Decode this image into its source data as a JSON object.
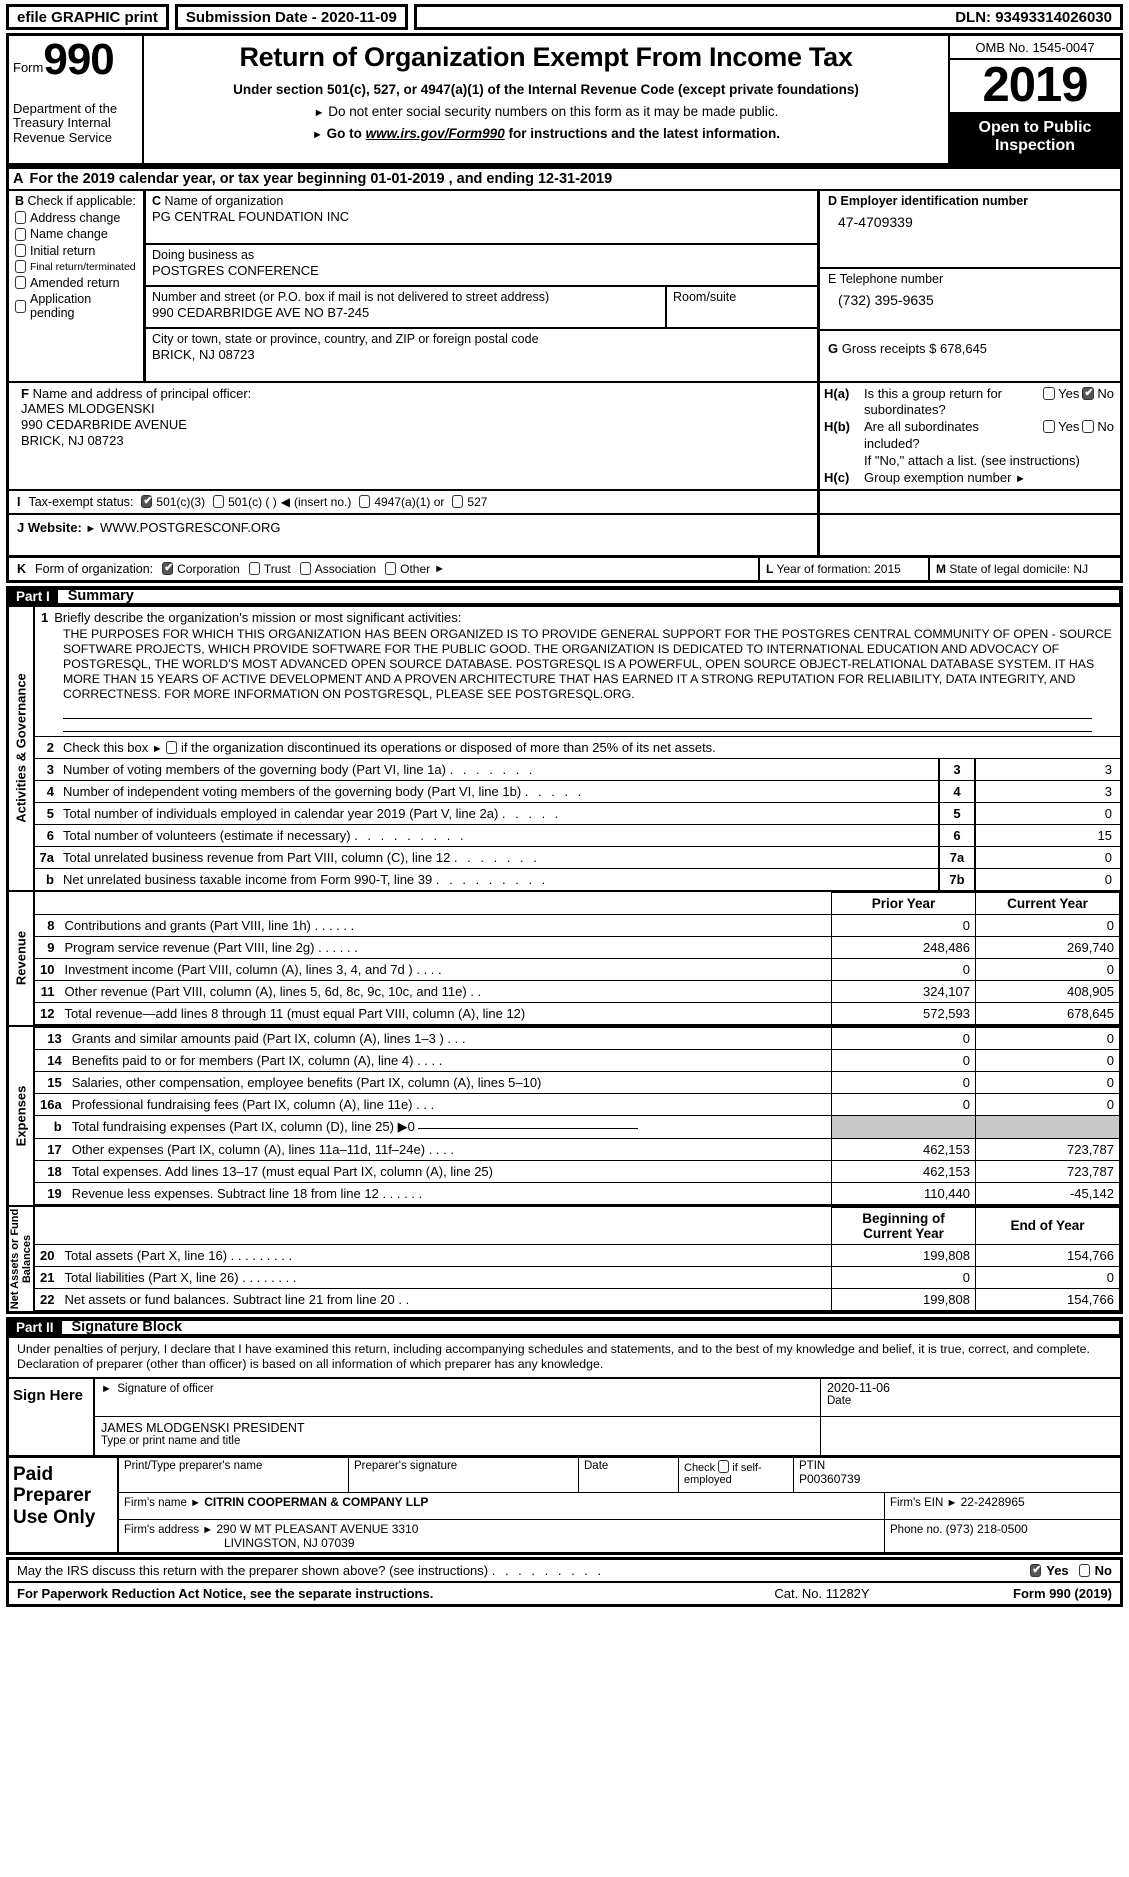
{
  "efile": {
    "graphic_print": "efile GRAPHIC print",
    "submission_label": "Submission Date - 2020-11-09",
    "dln": "DLN: 93493314026030"
  },
  "masthead": {
    "form_word": "Form",
    "form_number": "990",
    "department": "Department of the Treasury Internal Revenue Service",
    "title": "Return of Organization Exempt From Income Tax",
    "subtitle": "Under section 501(c), 527, or 4947(a)(1) of the Internal Revenue Code (except private foundations)",
    "note1": "Do not enter social security numbers on this form as it may be made public.",
    "note2_prefix": "Go to",
    "note2_link": "www.irs.gov/Form990",
    "note2_suffix": "for instructions and the latest information.",
    "omb": "OMB No. 1545-0047",
    "year": "2019",
    "open_to_public": "Open to Public Inspection"
  },
  "sectionA": {
    "letter": "A",
    "text": "For the 2019 calendar year, or tax year beginning 01-01-2019    , and ending 12-31-2019"
  },
  "sectionB": {
    "letter": "B",
    "heading": "Check if applicable:",
    "items": [
      "Address change",
      "Name change",
      "Initial return",
      "Final return/terminated",
      "Amended return",
      "Application pending"
    ]
  },
  "sectionC": {
    "letter": "C",
    "name_label": "Name of organization",
    "name_value": "PG CENTRAL FOUNDATION INC",
    "dba_label": "Doing business as",
    "dba_value": "POSTGRES CONFERENCE",
    "street_label": "Number and street (or P.O. box if mail is not delivered to street address)",
    "street_value": "990 CEDARBRIDGE AVE NO B7-245",
    "room_label": "Room/suite",
    "room_value": "",
    "city_label": "City or town, state or province, country, and ZIP or foreign postal code",
    "city_value": "BRICK, NJ  08723"
  },
  "sectionD": {
    "letter": "D",
    "label": "Employer identification number",
    "value": "47-4709339"
  },
  "sectionE": {
    "letter": "E",
    "label": "Telephone number",
    "value": "(732) 395-9635"
  },
  "sectionG": {
    "letter": "G",
    "label": "Gross receipts $",
    "value": "678,645"
  },
  "sectionF": {
    "letter": "F",
    "label": "Name and address of principal officer:",
    "lines": [
      "JAMES MLODGENSKI",
      "990 CEDARBRIDE AVENUE",
      "BRICK, NJ  08723"
    ]
  },
  "sectionH": {
    "a_key": "H(a)",
    "a_text": "Is this a group return for subordinates?",
    "a_yes": "Yes",
    "a_no": "No",
    "a_checked": "No",
    "b_key": "H(b)",
    "b_text": "Are all subordinates included?",
    "b_yes": "Yes",
    "b_no": "No",
    "b_note": "If \"No,\" attach a list. (see instructions)",
    "c_key": "H(c)",
    "c_text": "Group exemption number"
  },
  "sectionI": {
    "letter": "I",
    "label": "Tax-exempt status:",
    "options": [
      "501(c)(3)",
      "501(c) (   )",
      "(insert no.)",
      "4947(a)(1) or",
      "527"
    ],
    "checked": "501(c)(3)"
  },
  "sectionJ": {
    "letter": "J",
    "label": "Website:",
    "value": "WWW.POSTGRESCONF.ORG"
  },
  "sectionK": {
    "letter": "K",
    "label": "Form of organization:",
    "options": [
      "Corporation",
      "Trust",
      "Association",
      "Other"
    ],
    "checked": "Corporation"
  },
  "sectionL": {
    "letter": "L",
    "label": "Year of formation:",
    "value": "2015"
  },
  "sectionM": {
    "letter": "M",
    "label": "State of legal domicile:",
    "value": "NJ"
  },
  "part1": {
    "part_no": "Part I",
    "title": "Summary",
    "side_tab": "Activities & Governance",
    "line1_num": "1",
    "line1_label": "Briefly describe the organization's mission or most significant activities:",
    "mission_text": "THE PURPOSES FOR WHICH THIS ORGANIZATION HAS BEEN ORGANIZED IS TO PROVIDE GENERAL SUPPORT FOR THE POSTGRES CENTRAL COMMUNITY OF OPEN - SOURCE SOFTWARE PROJECTS, WHICH PROVIDE SOFTWARE FOR THE PUBLIC GOOD. THE ORGANIZATION IS DEDICATED TO INTERNATIONAL EDUCATION AND ADVOCACY OF POSTGRESQL, THE WORLD'S MOST ADVANCED OPEN SOURCE DATABASE. POSTGRESQL IS A POWERFUL, OPEN SOURCE OBJECT-RELATIONAL DATABASE SYSTEM. IT HAS MORE THAN 15 YEARS OF ACTIVE DEVELOPMENT AND A PROVEN ARCHITECTURE THAT HAS EARNED IT A STRONG REPUTATION FOR RELIABILITY, DATA INTEGRITY, AND CORRECTNESS. FOR MORE INFORMATION ON POSTGRESQL, PLEASE SEE POSTGRESQL.ORG.",
    "line2_num": "2",
    "line2_text": "Check this box",
    "line2_text2": "if the organization discontinued its operations or disposed of more than 25% of its net assets.",
    "gov_rows": [
      {
        "num": "3",
        "text": "Number of voting members of the governing body (Part VI, line 1a)",
        "box": "3",
        "value": "3"
      },
      {
        "num": "4",
        "text": "Number of independent voting members of the governing body (Part VI, line 1b)",
        "box": "4",
        "value": "3"
      },
      {
        "num": "5",
        "text": "Total number of individuals employed in calendar year 2019 (Part V, line 2a)",
        "box": "5",
        "value": "0"
      },
      {
        "num": "6",
        "text": "Total number of volunteers (estimate if necessary)",
        "box": "6",
        "value": "15"
      },
      {
        "num": "7a",
        "text": "Total unrelated business revenue from Part VIII, column (C), line 12",
        "box": "7a",
        "value": "0"
      },
      {
        "num": "b",
        "text": "Net unrelated business taxable income from Form 990-T, line 39",
        "box": "7b",
        "value": "0"
      }
    ],
    "revenue_tab": "Revenue",
    "revenue_header": [
      "Prior Year",
      "Current Year"
    ],
    "revenue_rows": [
      {
        "num": "8",
        "text": "Contributions and grants (Part VIII, line 1h)",
        "prior": "0",
        "current": "0"
      },
      {
        "num": "9",
        "text": "Program service revenue (Part VIII, line 2g)",
        "prior": "248,486",
        "current": "269,740"
      },
      {
        "num": "10",
        "text": "Investment income (Part VIII, column (A), lines 3, 4, and 7d )",
        "prior": "0",
        "current": "0"
      },
      {
        "num": "11",
        "text": "Other revenue (Part VIII, column (A), lines 5, 6d, 8c, 9c, 10c, and 11e)",
        "prior": "324,107",
        "current": "408,905"
      },
      {
        "num": "12",
        "text": "Total revenue—add lines 8 through 11 (must equal Part VIII, column (A), line 12)",
        "prior": "572,593",
        "current": "678,645"
      }
    ],
    "expenses_tab": "Expenses",
    "expenses_rows": [
      {
        "num": "13",
        "text": "Grants and similar amounts paid (Part IX, column (A), lines 1–3 )",
        "prior": "0",
        "current": "0"
      },
      {
        "num": "14",
        "text": "Benefits paid to or for members (Part IX, column (A), line 4)",
        "prior": "0",
        "current": "0"
      },
      {
        "num": "15",
        "text": "Salaries, other compensation, employee benefits (Part IX, column (A), lines 5–10)",
        "prior": "0",
        "current": "0"
      },
      {
        "num": "16a",
        "text": "Professional fundraising fees (Part IX, column (A), line 11e)",
        "prior": "0",
        "current": "0"
      },
      {
        "num": "b",
        "text": "Total fundraising expenses (Part IX, column (D), line 25)",
        "fund_arrow": "▶0",
        "prior": "",
        "current": "",
        "gray": true
      },
      {
        "num": "17",
        "text": "Other expenses (Part IX, column (A), lines 11a–11d, 11f–24e)",
        "prior": "462,153",
        "current": "723,787"
      },
      {
        "num": "18",
        "text": "Total expenses. Add lines 13–17 (must equal Part IX, column (A), line 25)",
        "prior": "462,153",
        "current": "723,787"
      },
      {
        "num": "19",
        "text": "Revenue less expenses. Subtract line 18 from line 12",
        "prior": "110,440",
        "current": "-45,142"
      }
    ],
    "netassets_tab": "Net Assets or Fund Balances",
    "netassets_header": [
      "Beginning of Current Year",
      "End of Year"
    ],
    "netassets_rows": [
      {
        "num": "20",
        "text": "Total assets (Part X, line 16)",
        "begin": "199,808",
        "end": "154,766"
      },
      {
        "num": "21",
        "text": "Total liabilities (Part X, line 26)",
        "begin": "0",
        "end": "0"
      },
      {
        "num": "22",
        "text": "Net assets or fund balances. Subtract line 21 from line 20",
        "begin": "199,808",
        "end": "154,766"
      }
    ]
  },
  "part2": {
    "part_no": "Part II",
    "title": "Signature Block",
    "declaration": "Under penalties of perjury, I declare that I have examined this return, including accompanying schedules and statements, and to the best of my knowledge and belief, it is true, correct, and complete. Declaration of preparer (other than officer) is based on all information of which preparer has any knowledge.",
    "sign_here": "Sign Here",
    "sig_officer_label": "Signature of officer",
    "sig_date_label": "Date",
    "sig_date_value": "2020-11-06",
    "sig_name_value": "JAMES MLODGENSKI  PRESIDENT",
    "sig_name_label": "Type or print name and title",
    "paid_preparer": "Paid Preparer Use Only",
    "prep_name_label": "Print/Type preparer's name",
    "prep_sig_label": "Preparer's signature",
    "prep_date_label": "Date",
    "prep_check_label": "Check",
    "prep_check_label2": "if self-employed",
    "prep_ptin_label": "PTIN",
    "prep_ptin_value": "P00360739",
    "firm_name_label": "Firm's name",
    "firm_name_value": "CITRIN COOPERMAN & COMPANY LLP",
    "firm_ein_label": "Firm's EIN",
    "firm_ein_value": "22-2428965",
    "firm_addr_label": "Firm's address",
    "firm_addr_value": "290 W MT PLEASANT AVENUE 3310",
    "firm_addr_value2": "LIVINGSTON, NJ  07039",
    "firm_phone_label": "Phone no.",
    "firm_phone_value": "(973) 218-0500"
  },
  "irs_question": {
    "text": "May the IRS discuss this return with the preparer shown above? (see instructions)",
    "yes": "Yes",
    "no": "No",
    "checked": "Yes"
  },
  "footer": {
    "left": "For Paperwork Reduction Act Notice, see the separate instructions.",
    "center": "Cat. No. 11282Y",
    "right": "Form 990 (2019)"
  }
}
